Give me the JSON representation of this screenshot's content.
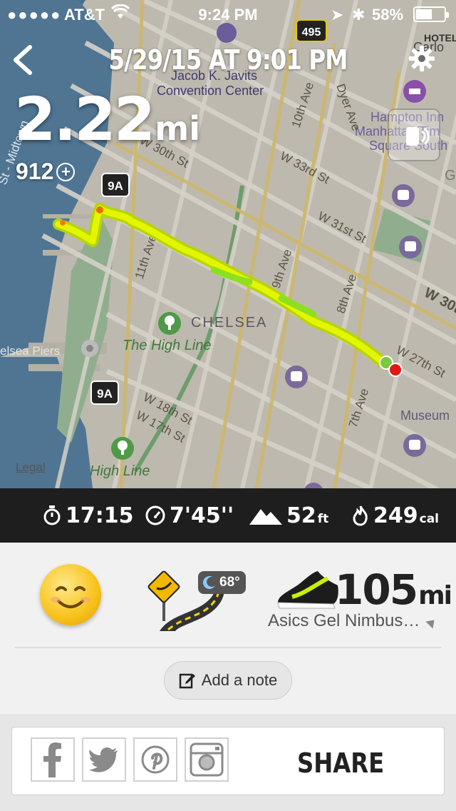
{
  "status_bar": {
    "carrier": "AT&T",
    "time": "9:24 PM",
    "battery": "58%",
    "battery_level": 0.58
  },
  "header": {
    "title": "5/29/15 AT 9:01 PM",
    "back_icon": "chevron-left-icon",
    "settings_icon": "gear-icon"
  },
  "summary": {
    "distance": "2.22",
    "distance_unit": "mi",
    "fuel": "912"
  },
  "map": {
    "labels": {
      "javits1": "Jacob K. Javits",
      "javits2": "Convention Center",
      "hampton1": "Hampton Inn",
      "hampton2": "Manhattan/Tim",
      "hampton3": "Square South",
      "w30": "W 30th St",
      "w33": "W 33rd St",
      "w31": "W 31st St",
      "w27": "W 27th St",
      "w30b": "W 30t",
      "w18": "W 18th St",
      "w17": "W 17th St",
      "ave10": "10th Ave",
      "ave11": "11th Ave",
      "ave9": "9th Ave",
      "ave8": "8th Ave",
      "ave7": "7th Ave",
      "dyer": "Dyer Ave",
      "chelsea": "CHELSEA",
      "highline": "The High Line",
      "highline2": "High Line",
      "piers": "elsea Piers",
      "museum": "Museum",
      "midtown": "St - Midtown",
      "route9a": "9A",
      "route495": "495",
      "carlo": "Carlo",
      "hotel": "HOTEL",
      "g": "G"
    },
    "legal": "Legal",
    "route_color": "#c8f000"
  },
  "stats": {
    "duration": "17:15",
    "pace": "7'45''",
    "elevation": "52",
    "elevation_unit": "ft",
    "calories": "249",
    "calories_unit": "cal"
  },
  "details": {
    "mood_icon": "smiley-icon",
    "terrain_icon": "road-icon",
    "temperature": "68°",
    "shoe_miles": "105",
    "shoe_unit": "mi",
    "shoe_name": "Asics Gel Nimbus…",
    "add_note": "Add a note"
  },
  "share": {
    "label": "SHARE",
    "networks": [
      "facebook-icon",
      "twitter-icon",
      "pinterest-icon",
      "instagram-icon"
    ]
  }
}
